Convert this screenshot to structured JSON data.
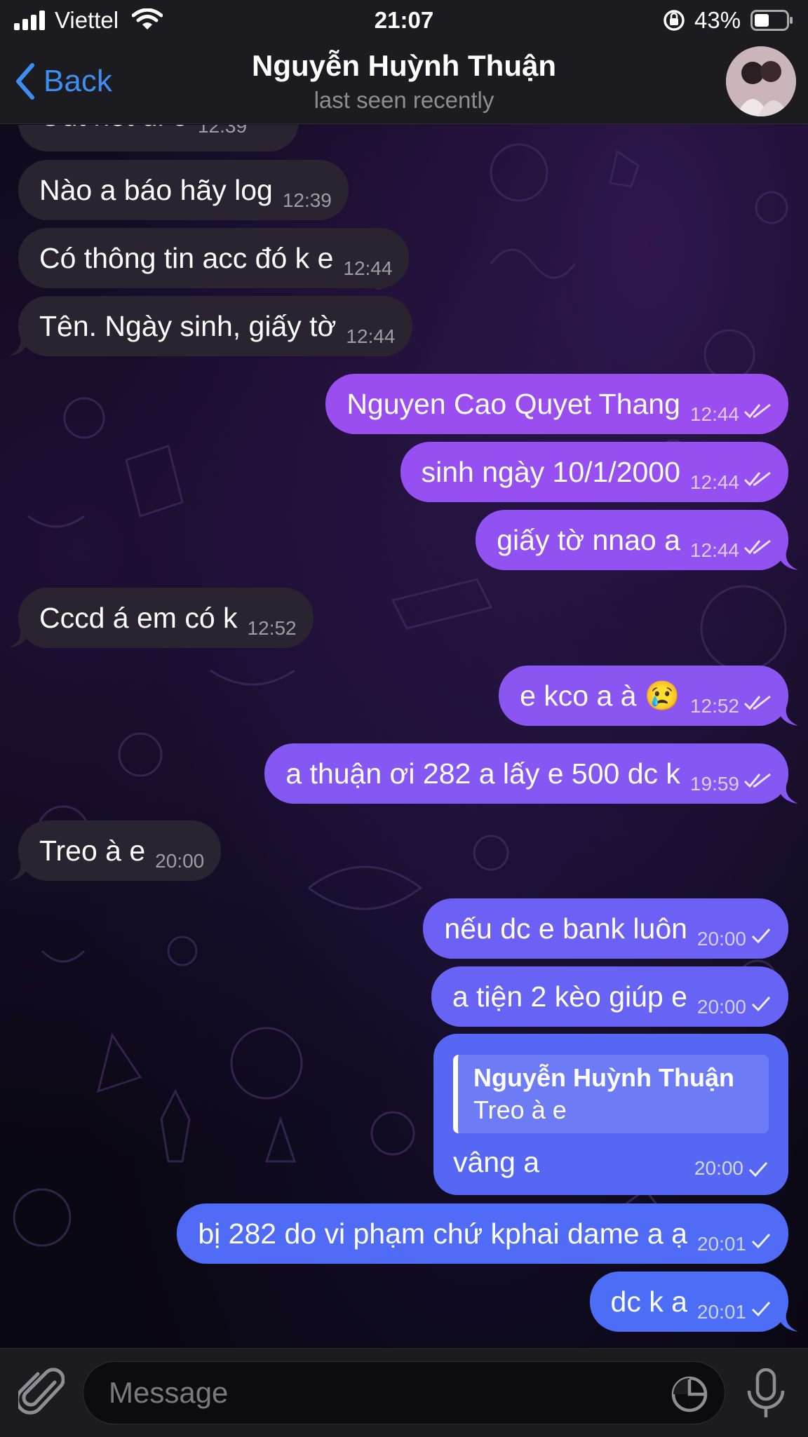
{
  "status_bar": {
    "carrier": "Viettel",
    "time": "21:07",
    "battery": "43%"
  },
  "header": {
    "back_label": "Back",
    "title": "Nguyễn Huỳnh Thuận",
    "subtitle": "last seen recently"
  },
  "messages": [
    {
      "text": "Out hết di e",
      "time": "12:39",
      "direction": "in"
    },
    {
      "text": "Nào a báo hãy log",
      "time": "12:39",
      "direction": "in"
    },
    {
      "text": "Có thông tin acc đó k e",
      "time": "12:44",
      "direction": "in"
    },
    {
      "text": "Tên. Ngày sinh, giấy tờ",
      "time": "12:44",
      "direction": "in"
    },
    {
      "text": "Nguyen Cao Quyet Thang",
      "time": "12:44",
      "direction": "out",
      "status": "read"
    },
    {
      "text": "sinh ngày 10/1/2000",
      "time": "12:44",
      "direction": "out",
      "status": "read"
    },
    {
      "text": "giấy tờ nnao a",
      "time": "12:44",
      "direction": "out",
      "status": "read"
    },
    {
      "text": "Cccd á em có k",
      "time": "12:52",
      "direction": "in"
    },
    {
      "text": "e kco a à 😢",
      "time": "12:52",
      "direction": "out",
      "status": "read"
    },
    {
      "text": "a thuận ơi 282 a lấy e 500 dc k",
      "time": "19:59",
      "direction": "out",
      "status": "read"
    },
    {
      "text": "Treo à e",
      "time": "20:00",
      "direction": "in"
    },
    {
      "text": "nếu dc e bank luôn",
      "time": "20:00",
      "direction": "out",
      "status": "sent"
    },
    {
      "text": "a tiện 2 kèo giúp e",
      "time": "20:00",
      "direction": "out",
      "status": "sent"
    },
    {
      "text": "vâng a",
      "time": "20:00",
      "direction": "out",
      "status": "sent",
      "reply_to": {
        "author": "Nguyễn Huỳnh Thuận",
        "text": "Treo à e"
      }
    },
    {
      "text": "bị 282 do vi phạm chứ kphai dame a ạ",
      "time": "20:01",
      "direction": "out",
      "status": "sent"
    },
    {
      "text": "dc k a",
      "time": "20:01",
      "direction": "out",
      "status": "sent"
    }
  ],
  "input": {
    "placeholder": "Message"
  },
  "icons": {
    "attach": "paperclip-icon",
    "sticker": "sticker-icon",
    "mic": "microphone-icon",
    "back": "chevron-left-icon"
  },
  "colors": {
    "accent": "#3e8df0",
    "incoming_bubble": "#2a2330",
    "outgoing_top": "#9a4ef0",
    "outgoing_bottom": "#4c6df5",
    "bar_background": "#1c1b1f"
  }
}
